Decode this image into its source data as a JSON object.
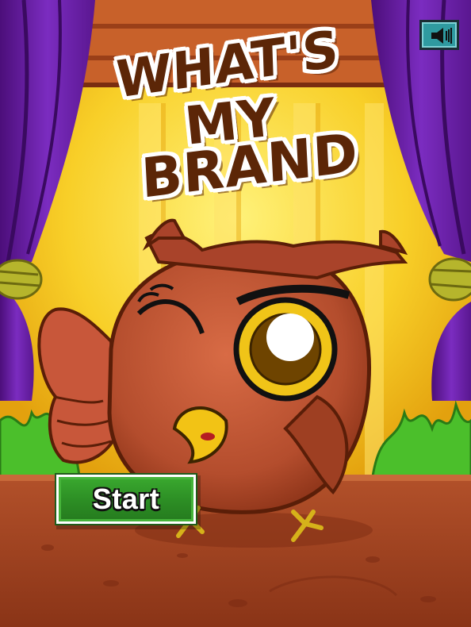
{
  "title": {
    "line1": "WHAT'S",
    "line2": "MY",
    "line3": "BRAND"
  },
  "buttons": {
    "start_label": "Start",
    "sound_icon": "speaker-icon"
  },
  "colors": {
    "title_text": "#5c2607",
    "title_outline": "#ffffff",
    "curtain": "#6a1fa0",
    "wall": "#f6c21f",
    "floor": "#9c3f20",
    "start_button": "#2c8d24",
    "sound_button": "#2f9aa0",
    "owl_body": "#b04a2c"
  }
}
